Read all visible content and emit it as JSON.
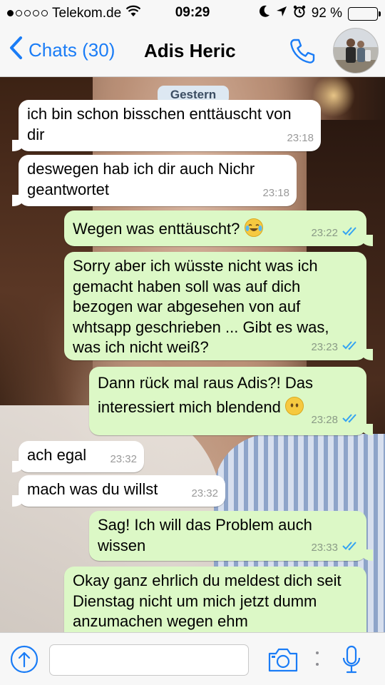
{
  "status_bar": {
    "carrier": "Telekom.de",
    "time": "09:29",
    "battery": "92 %",
    "battery_level": 0.92
  },
  "header": {
    "back_label": "Chats (30)",
    "contact_name": "Adis Heric",
    "icons": [
      "chevron-left-icon",
      "phone-icon",
      "avatar"
    ]
  },
  "chat": {
    "day_label": "Gestern",
    "messages": [
      {
        "dir": "in",
        "text": "ich bin schon bisschen enttäuscht von dir",
        "time": "23:18"
      },
      {
        "dir": "in",
        "text": "deswegen hab ich dir auch Nichr geantwortet",
        "time": "23:18"
      },
      {
        "dir": "out",
        "text": "Wegen was enttäuscht?",
        "emoji": "laughing-tears",
        "time": "23:22"
      },
      {
        "dir": "out",
        "text": "Sorry aber ich wüsste nicht was ich gemacht haben soll was auf dich bezogen war abgesehen von auf whtsapp geschrieben ... Gibt es was, was ich nicht weiß?",
        "time": "23:23"
      },
      {
        "dir": "out",
        "text": "Dann rück mal raus Adis?! Das interessiert mich blendend",
        "emoji": "no-mouth-face",
        "time": "23:28"
      },
      {
        "dir": "in",
        "text": "ach egal",
        "time": "23:32"
      },
      {
        "dir": "in",
        "text": "mach was du willst",
        "time": "23:32"
      },
      {
        "dir": "out",
        "text": "Sag! Ich will das Problem auch wissen",
        "time": "23:33"
      },
      {
        "dir": "out",
        "text": "Okay ganz ehrlich du meldest dich seit Dienstag nicht um mich jetzt dumm anzumachen wegen ehm"
      }
    ]
  },
  "composer": {
    "input_placeholder": "",
    "icons": [
      "upload-icon",
      "camera-icon",
      "more-dots-icon",
      "microphone-icon"
    ]
  },
  "colors": {
    "accent": "#1a7cf6",
    "incoming_bubble": "#ffffff",
    "outgoing_bubble": "#dcf8c6",
    "read_ticks": "#34a3f2"
  }
}
